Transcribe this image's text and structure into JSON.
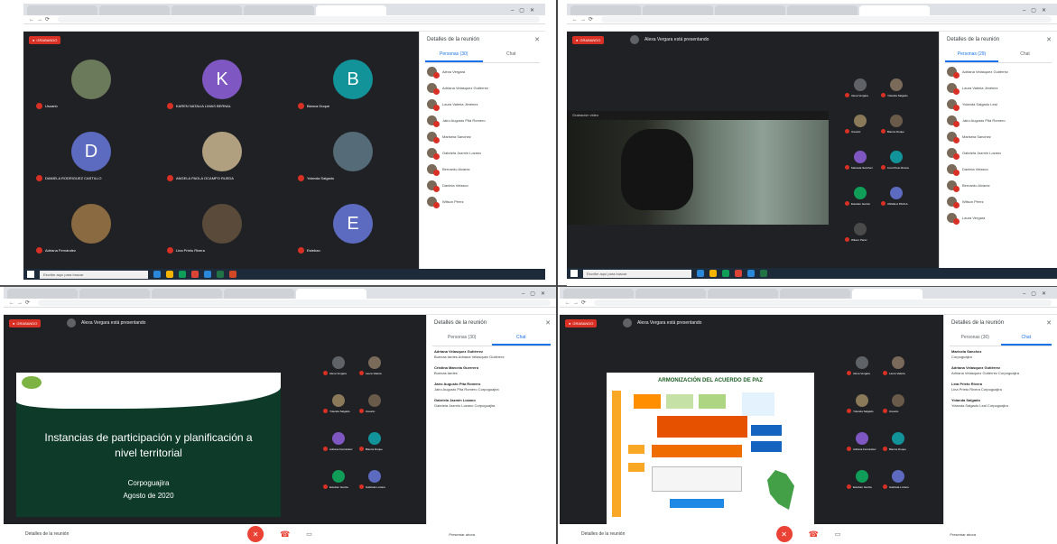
{
  "screens": {
    "s1": {
      "rec": "GRABANDO",
      "side_title": "Detalles de la reunión",
      "tab_people": "Personas (30)",
      "tab_chat": "Chat",
      "tiles": [
        {
          "name": "Usuario",
          "letter": "",
          "color": "#6a7a5a"
        },
        {
          "name": "KAREN NATALIA LIMAS BERNAL",
          "letter": "K",
          "color": "#7e57c2"
        },
        {
          "name": "Bianca Duque",
          "letter": "B",
          "color": "#12939a"
        },
        {
          "name": "DANIELA RODRIGUEZ CASTILLO",
          "letter": "D",
          "color": "#5c6bc0"
        },
        {
          "name": "ANGELA PAOLA OCAMPO RUEDA",
          "letter": "",
          "color": "#b0a080"
        },
        {
          "name": "Yolanda Salgado",
          "letter": "",
          "color": "#556b77"
        },
        {
          "name": "Adriana Fernández",
          "letter": "",
          "color": "#8a6a40"
        },
        {
          "name": "Lina Prieto Rivera",
          "letter": "",
          "color": "#5a4a3a"
        },
        {
          "name": "Esteban",
          "letter": "E",
          "color": "#5c6bc0"
        }
      ],
      "participants": [
        "Alexa Vergara",
        "Adriana Velasquez Gutiérrez",
        "Laura Valeria Jiménez",
        "Jairo Augusto Pita Romero",
        "Marisela Sanchez",
        "Gabriela Jazmín Lozano",
        "Bernardo Alvarez",
        "Daniela Velasco",
        "Wilson Pérez"
      ],
      "taskbar_search": "Escribe aquí para buscar"
    },
    "s2": {
      "rec": "GRABANDO",
      "presenting": "Alexa Vergara está presentando",
      "side_title": "Detalles de la reunión",
      "tab_people": "Personas (29)",
      "tab_chat": "Chat",
      "participants": [
        "Adriana Velasquez Gutiérrez",
        "Laura Valeria Jiménez",
        "Yolanda Salgado Leal",
        "Jairo Augusto Pita Romero",
        "Marisela Sanchez",
        "Gabriela Jazmín Lozano",
        "Daniela Velasco",
        "Bernardo Alvarez",
        "Wilson Pérez",
        "Laura Vergara"
      ],
      "video_label": "Grabación video",
      "taskbar_search": "Escribe aquí para buscar",
      "tiles": [
        "Alexa Vergara",
        "Yolanda Salgado",
        "Usuario",
        "Bianca Duque",
        "Marisela Sanchez",
        "Lina Prieto Rivera",
        "Esteban Garcia",
        "ANGELA PAOLA",
        "Wilson Pérez"
      ]
    },
    "s3": {
      "rec": "GRABANDO",
      "presenting": "Alexa Vergara está presentando",
      "side_title": "Detalles de la reunión",
      "tab_people": "Personas (30)",
      "tab_chat": "Chat",
      "slide_title": "Instancias de participación y planificación a nivel territorial",
      "slide_sub1": "Corpoguajira",
      "slide_sub2": "Agosto de 2020",
      "tiles": [
        "Alexa Vergara",
        "Laura Valeria",
        "Yolanda Salgado",
        "Usuario",
        "Adriana Fernández",
        "Bianca Duque",
        "Esteban Garcia",
        "Gabriela Lozano"
      ],
      "chat": [
        {
          "who": "Adriana Velasquez Gutiérrez",
          "text": "Buenas tardes Adriana Velasquez Gutiérrez"
        },
        {
          "who": "Cristina Marcela Guerrero",
          "text": "Buenas tardes"
        },
        {
          "who": "Jairo Augusto Pita Romero",
          "text": "Jairo Augusto Pita Romero Corpoguajira"
        },
        {
          "who": "Gabriela Jazmín Lozano",
          "text": "Gabriela Jazmín Lozano Corpoguajira"
        }
      ],
      "bottom_label": "Detalles de la reunión",
      "present_label": "Presentar ahora"
    },
    "s4": {
      "rec": "GRABANDO",
      "presenting": "Alexa Vergara está presentando",
      "side_title": "Detalles de la reunión",
      "tab_people": "Personas (30)",
      "tab_chat": "Chat",
      "infographic_title": "ARMONIZACIÓN DEL ACUERDO DE PAZ",
      "tiles": [
        "Alexa Vergara",
        "Laura Valeria",
        "Yolanda Salgado",
        "Usuario",
        "Adriana Fernández",
        "Bianca Duque",
        "Esteban Garcia",
        "Gabriela Lozano"
      ],
      "chat": [
        {
          "who": "Marisela Sanchez",
          "text": "Corpoguajira"
        },
        {
          "who": "Adriana Velasquez Gutiérrez",
          "text": "Adriana Velasquez Gutiérrez Corpoguajira"
        },
        {
          "who": "Lina Prieto Rivera",
          "text": "Lina Prieto Rivera Corpoguajira"
        },
        {
          "who": "Yolanda Salgado",
          "text": "Yolanda Salgado Leal Corpoguajira"
        }
      ],
      "bottom_label": "Detalles de la reunión",
      "present_label": "Presentar ahora"
    }
  }
}
